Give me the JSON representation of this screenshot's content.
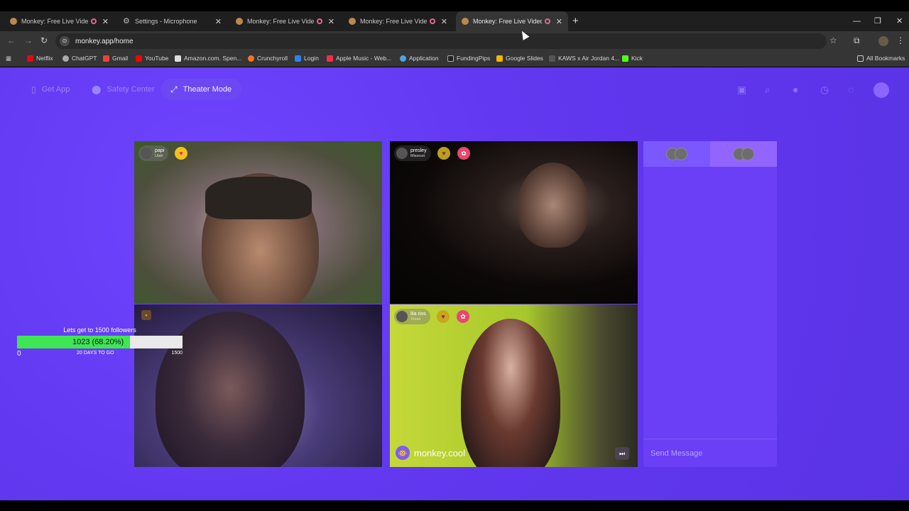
{
  "browser": {
    "tabs": [
      {
        "title": "Monkey: Free Live Video Ch",
        "icon": "monkey-favicon",
        "recording": true
      },
      {
        "title": "Settings - Microphone",
        "icon": "gear-icon",
        "recording": false
      },
      {
        "title": "Monkey: Free Live Video Ch",
        "icon": "monkey-favicon",
        "recording": true
      },
      {
        "title": "Monkey: Free Live Video Ch",
        "icon": "monkey-favicon",
        "recording": true
      },
      {
        "title": "Monkey: Free Live Video Ch",
        "icon": "monkey-favicon",
        "recording": true,
        "active": true
      }
    ],
    "new_tab": "+",
    "url": "monkey.app/home",
    "bookmarks": [
      "Netflix",
      "ChatGPT",
      "Gmail",
      "YouTube",
      "Amazon.com. Spen...",
      "Crunchyroll",
      "Login",
      "Apple Music - Web...",
      "Application",
      "FundingPips",
      "Google Slides",
      "KAWS x Air Jordan 4...",
      "Kick"
    ],
    "all_bookmarks": "All Bookmarks",
    "colors": {
      "tabstrip": "#1f1f1f",
      "toolbar": "#353535"
    }
  },
  "app": {
    "nav": {
      "get_app": "Get App",
      "safety_center": "Safety Center",
      "theater_mode": "Theater Mode"
    },
    "videos": [
      {
        "name": "papi",
        "location": "Utah"
      },
      {
        "name": "presley",
        "location": "Missouri"
      },
      {
        "name": "",
        "location": ""
      },
      {
        "name": "lila rios",
        "location": "Texas"
      }
    ],
    "watermark": "monkey.cool",
    "chat": {
      "placeholder": "Send Message"
    },
    "goal": {
      "title": "Lets get to 1500 followers",
      "progress_label": "1023 (68.20%)",
      "current": 1023,
      "progress_percent": 68.2,
      "min": "0",
      "max": "1500",
      "days_left": "20 DAYS TO GO"
    },
    "colors": {
      "background": "#5b33e6",
      "accent": "#6c48f3",
      "goal_fill": "#3ee653"
    }
  }
}
